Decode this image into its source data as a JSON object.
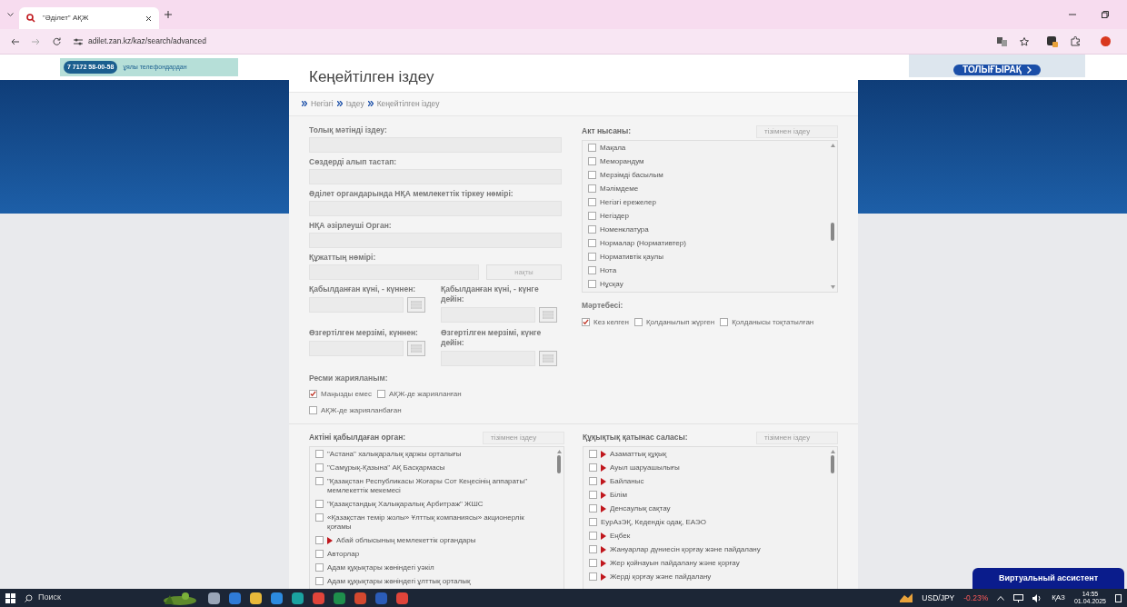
{
  "browser": {
    "tab_title": "\"Әділет\" АҚЖ",
    "url": "adilet.zan.kz/kaz/search/advanced"
  },
  "banner": {
    "phone": "7 7172 58-00-58",
    "note": "ұялы телефондардан",
    "more": "ТОЛЫҒЫРАҚ"
  },
  "page_title": "Кеңейтілген іздеу",
  "breadcrumb": [
    "Негізгі",
    "Іздеу",
    "Кеңейтілген іздеу"
  ],
  "fields": [
    {
      "label": "Толық мәтінді іздеу:"
    },
    {
      "label": "Сөздерді алып тастап:"
    },
    {
      "label": "Әділет органдарында НҚА мемлекеттік тіркеу нөмірі:"
    },
    {
      "label": "НҚА әзірлеуші Орган:"
    }
  ],
  "doc_number": {
    "label": "Құжаттың нөмірі:",
    "button": "нақты"
  },
  "dates": [
    {
      "label": "Қабылданған күні, - күннен:"
    },
    {
      "label": "Қабылданған күні, - күнге дейін:"
    },
    {
      "label": "Өзгертілген мерзімі, күннен:"
    },
    {
      "label": "Өзгертілген мерзімі, күнге дейін:"
    }
  ],
  "publication": {
    "label": "Ресми жарияланым:",
    "options": [
      {
        "label": "Маңызды емес",
        "checked": true
      },
      {
        "label": "АҚЖ-де жарияланған",
        "checked": false
      },
      {
        "label": "АҚЖ-де жарияланбаған",
        "checked": false
      }
    ]
  },
  "act_form": {
    "label": "Акт нысаны:",
    "search_placeholder": "тізімнен іздеу",
    "items": [
      {
        "label": "Мақала",
        "checked": false
      },
      {
        "label": "Меморандум",
        "checked": false
      },
      {
        "label": "Мерзімді басылым",
        "checked": false
      },
      {
        "label": "Мәлімдеме",
        "checked": false
      },
      {
        "label": "Негізгі ережелер",
        "checked": false
      },
      {
        "label": "Негіздер",
        "checked": false
      },
      {
        "label": "Номенклатура",
        "checked": false
      },
      {
        "label": "Нормалар (Нормативтер)",
        "checked": false
      },
      {
        "label": "Нормативтік қаулы",
        "checked": false
      },
      {
        "label": "Нота",
        "checked": false
      },
      {
        "label": "Нұсқау",
        "checked": false
      }
    ]
  },
  "status": {
    "label": "Мәртебесі:",
    "options": [
      {
        "label": "Кез келген",
        "checked": true
      },
      {
        "label": "Қолданылып жүрген",
        "checked": false
      },
      {
        "label": "Қолданысы тоқтатылған",
        "checked": false
      }
    ]
  },
  "adopting_body": {
    "label": "Актіні қабылдаған орган:",
    "search_placeholder": "тізімнен іздеу",
    "items": [
      {
        "label": "\"Астана\" халықаралық қаржы орталығы",
        "checked": false,
        "expandable": false
      },
      {
        "label": "\"Самұрық-Қазына\" АҚ Басқармасы",
        "checked": false,
        "expandable": false
      },
      {
        "label": "\"Қазақстан Республикасы Жоғары Сот Кеңесінің аппараты\" мемлекеттік мекемесі",
        "checked": false,
        "expandable": false
      },
      {
        "label": "\"Қазақстандық Халықаралық Арбитраж\" ЖШС",
        "checked": false,
        "expandable": false
      },
      {
        "label": "«Қазақстан темір жолы» Ұлттық компаниясы» акционерлік қоғамы",
        "checked": false,
        "expandable": false
      },
      {
        "label": "Абай облысының мемлекеттік органдары",
        "checked": false,
        "expandable": true
      },
      {
        "label": "Авторлар",
        "checked": false,
        "expandable": false
      },
      {
        "label": "Адам құқықтары жөніндегі уәкіл",
        "checked": false,
        "expandable": false
      },
      {
        "label": "Адам құқықтары жөніндегі ұлттық орталық",
        "checked": false,
        "expandable": false
      }
    ]
  },
  "legal_area": {
    "label": "Құқықтық қатынас саласы:",
    "search_placeholder": "тізімнен іздеу",
    "items": [
      {
        "label": "Азаматтық құқық",
        "checked": false,
        "expandable": true
      },
      {
        "label": "Ауыл шаруашылығы",
        "checked": false,
        "expandable": true
      },
      {
        "label": "Байланыс",
        "checked": false,
        "expandable": true
      },
      {
        "label": "Білім",
        "checked": false,
        "expandable": true
      },
      {
        "label": "Денсаулық сақтау",
        "checked": false,
        "expandable": true
      },
      {
        "label": "ЕурАзЭҚ, Кедендік одақ, ЕАЭО",
        "checked": false,
        "expandable": false
      },
      {
        "label": "Еңбек",
        "checked": false,
        "expandable": true
      },
      {
        "label": "Жануарлар дүниесін қорғау және пайдалану",
        "checked": false,
        "expandable": true
      },
      {
        "label": "Жер қойнауын пайдалану және қорғау",
        "checked": false,
        "expandable": true
      },
      {
        "label": "Жерді қорғау және пайдалану",
        "checked": false,
        "expandable": true
      }
    ]
  },
  "assistant": "Виртуальный ассистент",
  "taskbar": {
    "search": "Поиск",
    "ticker": "USD/JPY",
    "change": "-0.23%",
    "lang": "ҚАЗ",
    "time": "14:55",
    "date": "01.04.2025"
  }
}
